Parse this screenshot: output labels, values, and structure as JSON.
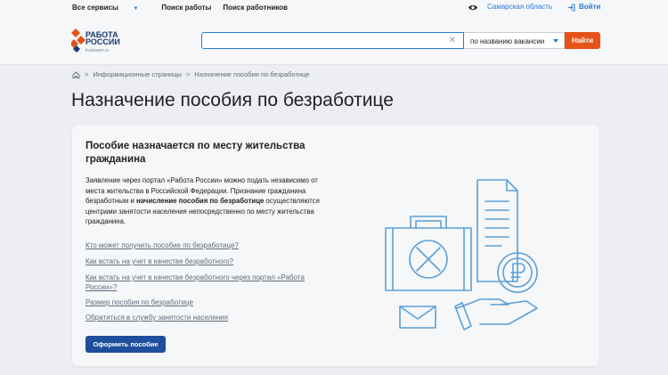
{
  "topnav": {
    "services": "Все сервисы",
    "find_job": "Поиск работы",
    "find_workers": "Поиск работников",
    "region": "Самарская область",
    "login": "Войти"
  },
  "header": {
    "logo_line1": "РАБОТА",
    "logo_line2": "РОССИИ",
    "logo_sub": "trudvsem.ru",
    "search_value": "",
    "search_mode": "по названию вакансии",
    "search_button": "Найти"
  },
  "breadcrumb": {
    "item1": "Информационные страницы",
    "item2": "Назначение пособия по безработице"
  },
  "page_title": "Назначение пособия по безработице",
  "card": {
    "title": "Пособие назначается по месту жительства гражданина",
    "desc_part1": "Заявление через портал «Работа России» можно подать независимо от места жительства в Российской Федерации. Признание гражданина безработным и ",
    "desc_bold": "начисление пособия по безработице",
    "desc_part2": " осуществляются центрами занятости населения непосредственно по месту жительства гражданина.",
    "links": [
      "Кто может получить пособие по безработице?",
      "Как встать на учет в качестве безработного?",
      "Как встать на учет в качестве безработного через портал «Работа России»?",
      "Размер пособия по безработице",
      "Обратиться в службу занятости населения"
    ],
    "cta": "Оформить пособие"
  },
  "colors": {
    "accent_orange": "#e5531a",
    "brand_blue": "#1f4f9c",
    "link_blue": "#2a7bd8",
    "illustration_blue": "#5aa0d8"
  }
}
